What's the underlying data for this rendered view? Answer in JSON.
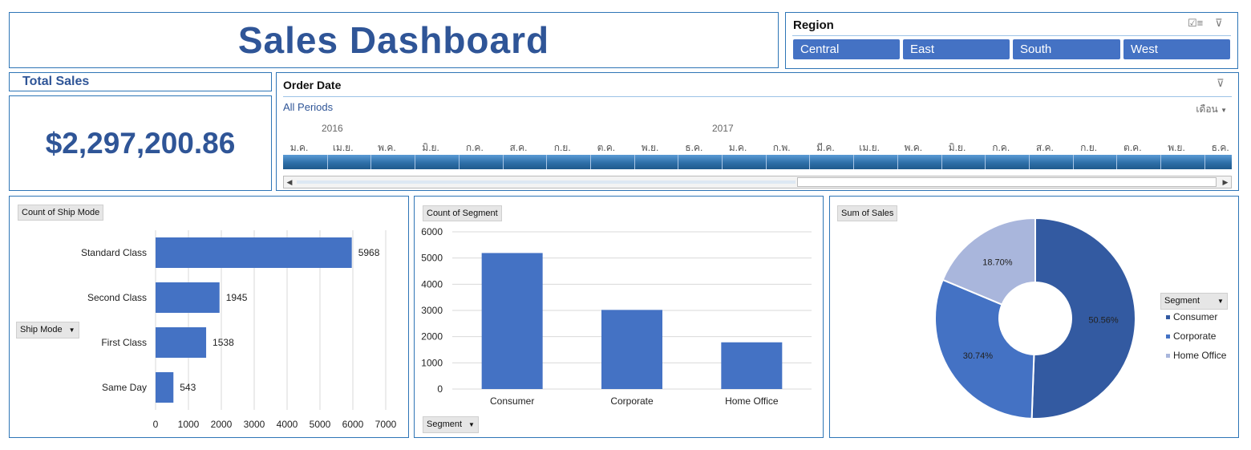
{
  "title": "Sales Dashboard",
  "region_slicer": {
    "header": "Region",
    "icons": [
      "multi-select-icon",
      "clear-filter-icon"
    ],
    "items": [
      "Central",
      "East",
      "South",
      "West"
    ]
  },
  "total_sales": {
    "label": "Total Sales",
    "value": "$2,297,200.86"
  },
  "timeline": {
    "header": "Order Date",
    "periods_label": "All Periods",
    "level_label": "เดือน",
    "years": [
      "2016",
      "2017"
    ],
    "months": [
      "ม.ค.",
      "เม.ย.",
      "พ.ค.",
      "มิ.ย.",
      "ก.ค.",
      "ส.ค.",
      "ก.ย.",
      "ต.ค.",
      "พ.ย.",
      "ธ.ค.",
      "ม.ค.",
      "ก.พ.",
      "มี.ค.",
      "เม.ย.",
      "พ.ค.",
      "มิ.ย.",
      "ก.ค.",
      "ส.ค.",
      "ก.ย.",
      "ต.ค.",
      "พ.ย.",
      "ธ.ค."
    ]
  },
  "colors": {
    "accent": "#2f5597",
    "bar": "#4472c4",
    "border": "#2e75b6",
    "light": "#a9b6dc",
    "dark": "#335aa1"
  },
  "panels": {
    "ship": {
      "value_button": "Count of Ship Mode",
      "axis_button": "Ship Mode"
    },
    "segment": {
      "value_button": "Count of Segment",
      "axis_button": "Segment"
    },
    "sales": {
      "value_button": "Sum of Sales",
      "legend_button": "Segment"
    }
  },
  "chart_data": [
    {
      "type": "bar",
      "orientation": "horizontal",
      "categories": [
        "Standard Class",
        "Second Class",
        "First Class",
        "Same Day"
      ],
      "values": [
        5968,
        1945,
        1538,
        543
      ],
      "xlim": [
        0,
        7000
      ],
      "xticks": [
        "0",
        "1000",
        "2000",
        "3000",
        "4000",
        "5000",
        "6000",
        "7000"
      ],
      "data_labels": [
        "5968",
        "1945",
        "1538",
        "543"
      ],
      "grid": true
    },
    {
      "type": "bar",
      "categories": [
        "Consumer",
        "Corporate",
        "Home Office"
      ],
      "values": [
        5191,
        3020,
        1783
      ],
      "ylim": [
        0,
        6000
      ],
      "yticks": [
        "0",
        "1000",
        "2000",
        "3000",
        "4000",
        "5000",
        "6000"
      ],
      "grid": true
    },
    {
      "type": "pie",
      "donut": true,
      "categories": [
        "Consumer",
        "Corporate",
        "Home Office"
      ],
      "values": [
        50.56,
        30.74,
        18.7
      ],
      "data_labels": [
        "50.56%",
        "30.74%",
        "18.70%"
      ],
      "colors": [
        "#335aa1",
        "#4472c4",
        "#a9b6dc"
      ],
      "legend_position": "right"
    }
  ]
}
